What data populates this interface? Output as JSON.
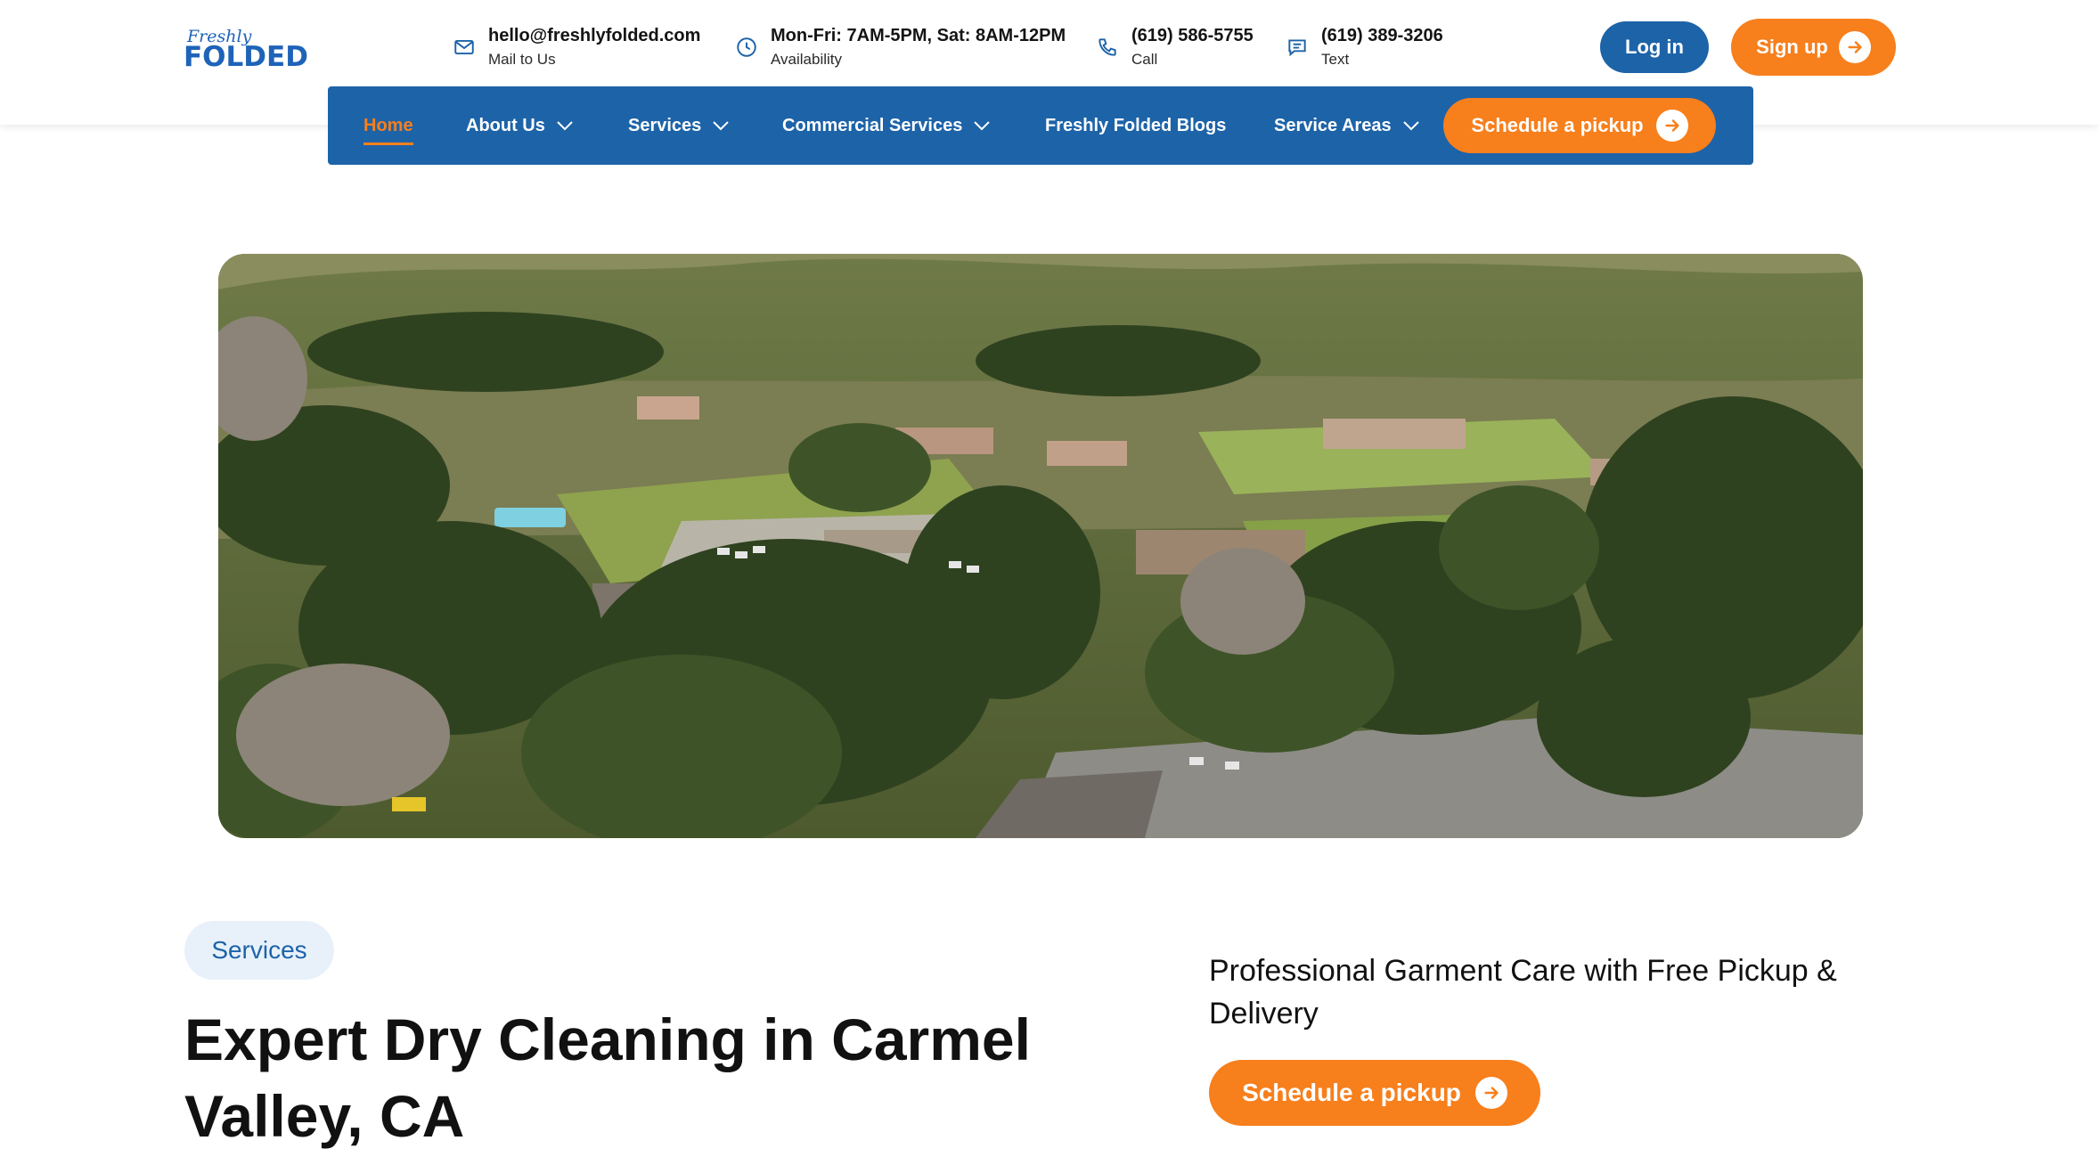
{
  "brand": {
    "logo_script": "Freshly",
    "logo_word": "FOLDED",
    "primary_color": "#1d63a8",
    "accent_color": "#f77f1c"
  },
  "header": {
    "contacts": [
      {
        "icon": "mail-icon",
        "main": "hello@freshlyfolded.com",
        "sub": "Mail to Us"
      },
      {
        "icon": "clock-icon",
        "main": "Mon-Fri: 7AM-5PM, Sat: 8AM-12PM",
        "sub": "Availability"
      },
      {
        "icon": "phone-icon",
        "main": "(619) 586-5755",
        "sub": "Call"
      },
      {
        "icon": "message-icon",
        "main": "(619) 389-3206",
        "sub": "Text"
      }
    ],
    "login_label": "Log in",
    "signup_label": "Sign up"
  },
  "nav": {
    "items": [
      {
        "label": "Home",
        "active": true,
        "dropdown": false
      },
      {
        "label": "About Us",
        "active": false,
        "dropdown": true
      },
      {
        "label": "Services",
        "active": false,
        "dropdown": true
      },
      {
        "label": "Commercial Services",
        "active": false,
        "dropdown": true
      },
      {
        "label": "Freshly Folded Blogs",
        "active": false,
        "dropdown": false
      },
      {
        "label": "Service Areas",
        "active": false,
        "dropdown": true
      }
    ],
    "cta_label": "Schedule a pickup"
  },
  "hero": {
    "image_subject": "aerial-view-carmel-valley"
  },
  "content": {
    "tag": "Services",
    "headline": "Expert Dry Cleaning in Carmel Valley, CA",
    "subheadline": "Professional Garment Care with Free Pickup & Delivery",
    "cta_label": "Schedule a pickup"
  }
}
